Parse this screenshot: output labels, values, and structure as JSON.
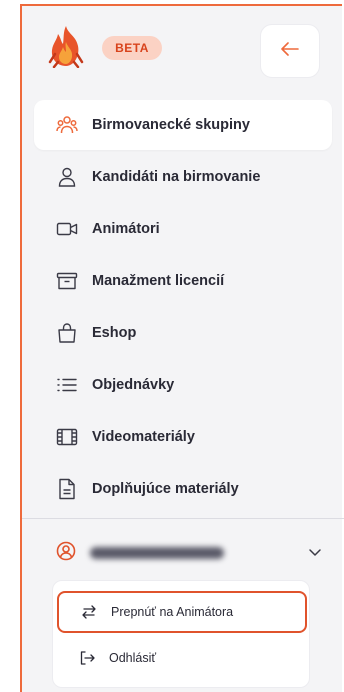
{
  "header": {
    "badge": "BETA",
    "logo_icon": "flame-icon",
    "back_icon": "arrow-left-icon",
    "accent_color": "#ee6a3c"
  },
  "nav": {
    "items": [
      {
        "label": "Birmovanecké skupiny",
        "icon": "users-group-icon",
        "active": true
      },
      {
        "label": "Kandidáti na birmovanie",
        "icon": "user-icon",
        "active": false
      },
      {
        "label": "Animátori",
        "icon": "video-camera-icon",
        "active": false
      },
      {
        "label": "Manažment licencií",
        "icon": "archive-box-icon",
        "active": false
      },
      {
        "label": "Eshop",
        "icon": "shopping-bag-icon",
        "active": false
      },
      {
        "label": "Objednávky",
        "icon": "list-icon",
        "active": false
      },
      {
        "label": "Videomateriály",
        "icon": "film-icon",
        "active": false
      },
      {
        "label": "Doplňujúce materiály",
        "icon": "document-icon",
        "active": false
      }
    ]
  },
  "user": {
    "avatar_icon": "user-circle-icon",
    "chevron_icon": "chevron-down-icon"
  },
  "menu": {
    "switch_label": "Prepnúť na Animátora",
    "switch_icon": "arrows-switch-icon",
    "logout_label": "Odhlásiť",
    "logout_icon": "logout-icon"
  }
}
